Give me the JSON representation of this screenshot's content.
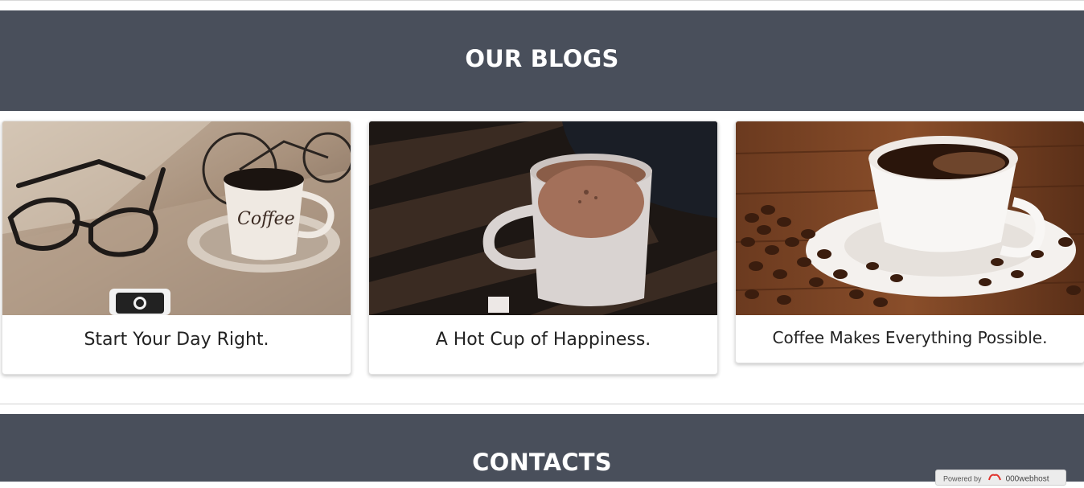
{
  "blogs_section": {
    "title": "OUR BLOGS",
    "cards": [
      {
        "caption": "Start Your Day Right.",
        "image": "coffee-cup-glasses-bicycle-photo"
      },
      {
        "caption": "A Hot Cup of Happiness.",
        "image": "hot-cocoa-mug-photo"
      },
      {
        "caption": "Coffee Makes Everything Possible.",
        "image": "coffee-cup-beans-photo"
      }
    ]
  },
  "contacts_section": {
    "title": "CONTACTS"
  },
  "hosting_badge": {
    "powered_by": "Powered by",
    "brand": "000webhost"
  },
  "colors": {
    "section_band": "#494f5b",
    "band_text": "#ffffff",
    "caption_text": "#222222"
  }
}
